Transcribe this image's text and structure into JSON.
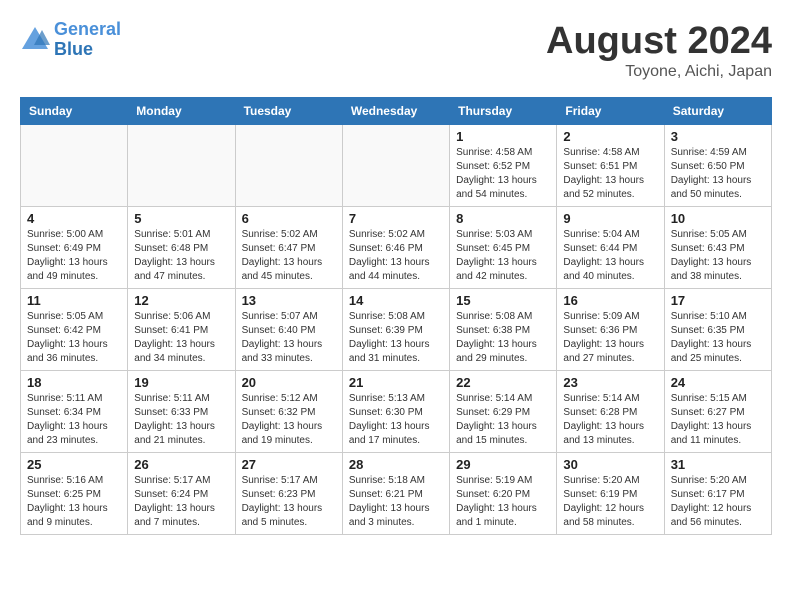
{
  "header": {
    "logo_line1": "General",
    "logo_line2": "Blue",
    "main_title": "August 2024",
    "subtitle": "Toyone, Aichi, Japan"
  },
  "weekdays": [
    "Sunday",
    "Monday",
    "Tuesday",
    "Wednesday",
    "Thursday",
    "Friday",
    "Saturday"
  ],
  "weeks": [
    [
      {
        "day": "",
        "info": ""
      },
      {
        "day": "",
        "info": ""
      },
      {
        "day": "",
        "info": ""
      },
      {
        "day": "",
        "info": ""
      },
      {
        "day": "1",
        "info": "Sunrise: 4:58 AM\nSunset: 6:52 PM\nDaylight: 13 hours\nand 54 minutes."
      },
      {
        "day": "2",
        "info": "Sunrise: 4:58 AM\nSunset: 6:51 PM\nDaylight: 13 hours\nand 52 minutes."
      },
      {
        "day": "3",
        "info": "Sunrise: 4:59 AM\nSunset: 6:50 PM\nDaylight: 13 hours\nand 50 minutes."
      }
    ],
    [
      {
        "day": "4",
        "info": "Sunrise: 5:00 AM\nSunset: 6:49 PM\nDaylight: 13 hours\nand 49 minutes."
      },
      {
        "day": "5",
        "info": "Sunrise: 5:01 AM\nSunset: 6:48 PM\nDaylight: 13 hours\nand 47 minutes."
      },
      {
        "day": "6",
        "info": "Sunrise: 5:02 AM\nSunset: 6:47 PM\nDaylight: 13 hours\nand 45 minutes."
      },
      {
        "day": "7",
        "info": "Sunrise: 5:02 AM\nSunset: 6:46 PM\nDaylight: 13 hours\nand 44 minutes."
      },
      {
        "day": "8",
        "info": "Sunrise: 5:03 AM\nSunset: 6:45 PM\nDaylight: 13 hours\nand 42 minutes."
      },
      {
        "day": "9",
        "info": "Sunrise: 5:04 AM\nSunset: 6:44 PM\nDaylight: 13 hours\nand 40 minutes."
      },
      {
        "day": "10",
        "info": "Sunrise: 5:05 AM\nSunset: 6:43 PM\nDaylight: 13 hours\nand 38 minutes."
      }
    ],
    [
      {
        "day": "11",
        "info": "Sunrise: 5:05 AM\nSunset: 6:42 PM\nDaylight: 13 hours\nand 36 minutes."
      },
      {
        "day": "12",
        "info": "Sunrise: 5:06 AM\nSunset: 6:41 PM\nDaylight: 13 hours\nand 34 minutes."
      },
      {
        "day": "13",
        "info": "Sunrise: 5:07 AM\nSunset: 6:40 PM\nDaylight: 13 hours\nand 33 minutes."
      },
      {
        "day": "14",
        "info": "Sunrise: 5:08 AM\nSunset: 6:39 PM\nDaylight: 13 hours\nand 31 minutes."
      },
      {
        "day": "15",
        "info": "Sunrise: 5:08 AM\nSunset: 6:38 PM\nDaylight: 13 hours\nand 29 minutes."
      },
      {
        "day": "16",
        "info": "Sunrise: 5:09 AM\nSunset: 6:36 PM\nDaylight: 13 hours\nand 27 minutes."
      },
      {
        "day": "17",
        "info": "Sunrise: 5:10 AM\nSunset: 6:35 PM\nDaylight: 13 hours\nand 25 minutes."
      }
    ],
    [
      {
        "day": "18",
        "info": "Sunrise: 5:11 AM\nSunset: 6:34 PM\nDaylight: 13 hours\nand 23 minutes."
      },
      {
        "day": "19",
        "info": "Sunrise: 5:11 AM\nSunset: 6:33 PM\nDaylight: 13 hours\nand 21 minutes."
      },
      {
        "day": "20",
        "info": "Sunrise: 5:12 AM\nSunset: 6:32 PM\nDaylight: 13 hours\nand 19 minutes."
      },
      {
        "day": "21",
        "info": "Sunrise: 5:13 AM\nSunset: 6:30 PM\nDaylight: 13 hours\nand 17 minutes."
      },
      {
        "day": "22",
        "info": "Sunrise: 5:14 AM\nSunset: 6:29 PM\nDaylight: 13 hours\nand 15 minutes."
      },
      {
        "day": "23",
        "info": "Sunrise: 5:14 AM\nSunset: 6:28 PM\nDaylight: 13 hours\nand 13 minutes."
      },
      {
        "day": "24",
        "info": "Sunrise: 5:15 AM\nSunset: 6:27 PM\nDaylight: 13 hours\nand 11 minutes."
      }
    ],
    [
      {
        "day": "25",
        "info": "Sunrise: 5:16 AM\nSunset: 6:25 PM\nDaylight: 13 hours\nand 9 minutes."
      },
      {
        "day": "26",
        "info": "Sunrise: 5:17 AM\nSunset: 6:24 PM\nDaylight: 13 hours\nand 7 minutes."
      },
      {
        "day": "27",
        "info": "Sunrise: 5:17 AM\nSunset: 6:23 PM\nDaylight: 13 hours\nand 5 minutes."
      },
      {
        "day": "28",
        "info": "Sunrise: 5:18 AM\nSunset: 6:21 PM\nDaylight: 13 hours\nand 3 minutes."
      },
      {
        "day": "29",
        "info": "Sunrise: 5:19 AM\nSunset: 6:20 PM\nDaylight: 13 hours\nand 1 minute."
      },
      {
        "day": "30",
        "info": "Sunrise: 5:20 AM\nSunset: 6:19 PM\nDaylight: 12 hours\nand 58 minutes."
      },
      {
        "day": "31",
        "info": "Sunrise: 5:20 AM\nSunset: 6:17 PM\nDaylight: 12 hours\nand 56 minutes."
      }
    ]
  ]
}
